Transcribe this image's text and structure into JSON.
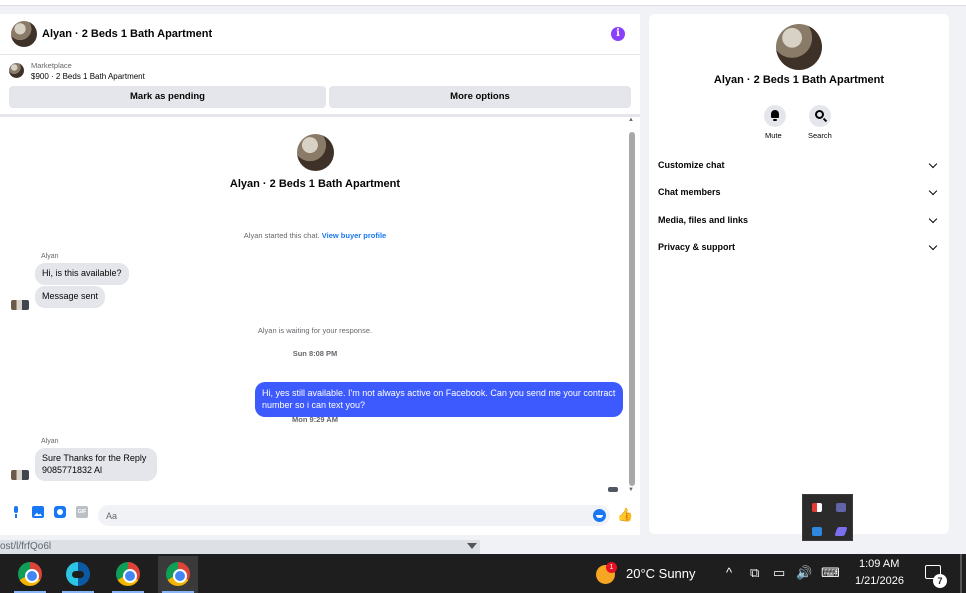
{
  "chat": {
    "title": "Alyan · 2 Beds 1 Bath Apartment",
    "info_icon": "i",
    "marketplace_label": "Marketplace",
    "listing_line": "$900 · 2 Beds 1 Bath Apartment",
    "mark_pending_label": "Mark as pending",
    "more_options_label": "More options",
    "conversation_title": "Alyan · 2 Beds 1 Bath Apartment",
    "started_text": "Alyan started this chat.",
    "view_profile_link": "View buyer profile",
    "messages": [
      {
        "sender": "Alyan",
        "text": "Hi, is this available?"
      },
      {
        "text": "Message sent"
      }
    ],
    "waiting_text": "Alyan is waiting for your response.",
    "time_1": "Sun 8:08 PM",
    "outgoing_text": "Hi, yes  still available. I'm not always active on Facebook. Can you send me your contract number so i can text you?",
    "time_2": "Mon 9:29 AM",
    "reply_sender": "Alyan",
    "reply_line1": "Sure Thanks for the Reply",
    "reply_line2": "9085771832 Al",
    "composer_placeholder": "Aa",
    "gif_label": "GIF",
    "like_icon": "👍"
  },
  "details": {
    "title": "Alyan · 2 Beds 1 Bath Apartment",
    "mute_label": "Mute",
    "search_label": "Search",
    "sections": [
      "Customize chat",
      "Chat members",
      "Media, files and links",
      "Privacy & support"
    ]
  },
  "browser": {
    "url_fragment": "ost/l/frfQo6l"
  },
  "taskbar": {
    "weather": "20°C  Sunny",
    "weather_badge": "1",
    "time": "1:09 AM",
    "date": "1/21/2026",
    "notification_count": "7",
    "tray_symbols": [
      "^",
      "⧉",
      "▭",
      "🔊",
      "⌨"
    ]
  },
  "colors": {
    "accent": "#1877f2",
    "outgoing_bubble": "#3d5afe",
    "info_icon": "#8a3ffc"
  }
}
